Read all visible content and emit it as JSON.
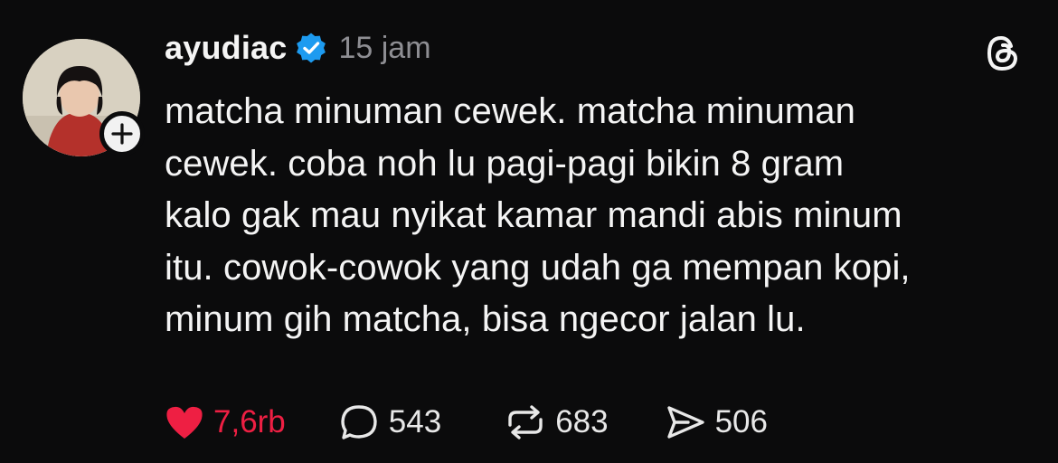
{
  "post": {
    "username": "ayudiac",
    "timestamp": "15 jam",
    "text": "matcha minuman cewek. matcha minuman\ncewek. coba noh lu pagi-pagi bikin 8 gram\nkalo gak mau nyikat kamar mandi abis minum\nitu. cowok-cowok yang udah ga mempan kopi,\nminum gih matcha, bisa ngecor jalan lu.",
    "avatar_icon": "user-photo",
    "follow_icon": "plus-icon",
    "verified_icon": "verified-badge-icon"
  },
  "actions": {
    "like_count": "7,6rb",
    "reply_count": "543",
    "repost_count": "683",
    "share_count": "506"
  },
  "colors": {
    "background": "#0b0b0c",
    "like": "#ee1f43",
    "verified": "#1d9bf0",
    "muted": "#8e8e93"
  }
}
